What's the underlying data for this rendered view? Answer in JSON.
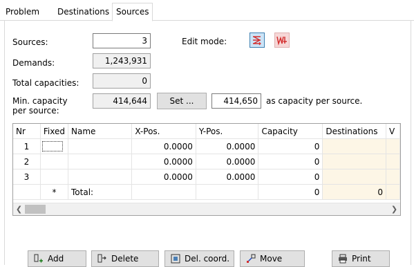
{
  "tabs": [
    "Problem",
    "Destinations",
    "Sources"
  ],
  "form": {
    "sources_label": "Sources:",
    "sources_value": "3",
    "edit_mode_label": "Edit mode:",
    "demands_label": "Demands:",
    "demands_value": "1,243,931",
    "total_capacities_label": "Total capacities:",
    "total_capacities_value": "0",
    "min_capacity_label_1": "Min. capacity",
    "min_capacity_label_2": "per source:",
    "min_capacity_value": "414,644",
    "set_label": "Set ...",
    "capacity_input": "414,650",
    "capacity_suffix": "as capacity per source."
  },
  "grid": {
    "headers": [
      "Nr",
      "Fixed",
      "Name",
      "X-Pos.",
      "Y-Pos.",
      "Capacity",
      "Destinations",
      "V"
    ],
    "rows": [
      {
        "nr": "1",
        "x": "0.0000",
        "y": "0.0000",
        "capacity": "0"
      },
      {
        "nr": "2",
        "x": "0.0000",
        "y": "0.0000",
        "capacity": "0"
      },
      {
        "nr": "3",
        "x": "0.0000",
        "y": "0.0000",
        "capacity": "0"
      }
    ],
    "total": {
      "star": "*",
      "label": "Total:",
      "capacity": "0",
      "destinations": "0"
    }
  },
  "buttons": {
    "add": "Add",
    "delete": "Delete",
    "del_coord": "Del. coord.",
    "move": "Move",
    "print": "Print"
  },
  "icons": {
    "mode1": "edit-mode-arrows-icon",
    "mode2": "edit-mode-waves-icon"
  },
  "colors": {
    "accent": "#3c7fb1",
    "mode_red": "#d32f2f",
    "destinations_bg": "#fdf6e6"
  }
}
